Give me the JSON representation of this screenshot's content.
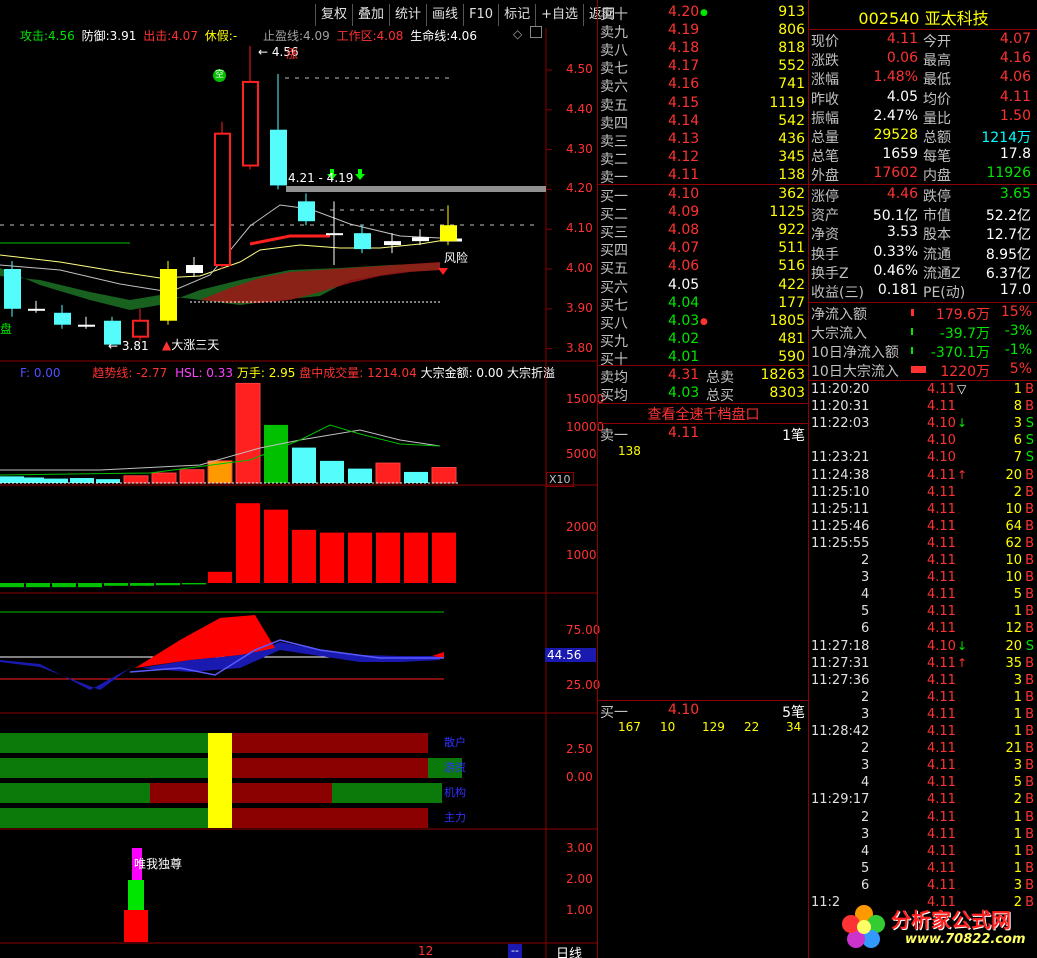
{
  "toolbar": [
    "复权",
    "叠加",
    "统计",
    "画线",
    "F10",
    "标记",
    "+自选",
    "返回"
  ],
  "main_indicator": {
    "attack_label": "攻击:",
    "attack_val": "4.56",
    "defense_label": "防御:",
    "defense_val": "3.91",
    "exit_label": "出击:",
    "exit_val": "4.07",
    "rest_label": "休假:",
    "rest_val": "-",
    "stop_label": "止盈线:",
    "stop_val": "4.09",
    "work_label": "工作区:",
    "work_val": "4.08",
    "life_label": "生命线:",
    "life_val": "4.06"
  },
  "price_axis": [
    "4.50",
    "4.40",
    "4.30",
    "4.20",
    "4.10",
    "4.00",
    "3.90",
    "3.80"
  ],
  "annotations": {
    "high": "4.56",
    "zhang": "涨",
    "range": "4.21 - 4.19",
    "low": "3.81",
    "dazhang": "大涨三天",
    "risk": "风险",
    "pan": "盘",
    "icon_text": "空"
  },
  "vol_indicator": {
    "f": "F: 0.00",
    "trend": "趋势线: -2.77",
    "hsl": "HSL: 0.33",
    "wanshou": "万手: 2.95",
    "pzcj": "盘中成交量: 1214.04",
    "dzje": "大宗金额: 0.00",
    "dzzy": "大宗折溢"
  },
  "vol_axis": [
    "15000",
    "10000",
    "5000"
  ],
  "vol_scale": "X10",
  "flow_axis": [
    "2000",
    "1000"
  ],
  "osc_axis": [
    "75.00",
    "25.00"
  ],
  "osc_value": "44.56",
  "band_axis": [
    "2.50",
    "0.00"
  ],
  "band_labels": [
    "散户",
    "游资",
    "机构",
    "主力"
  ],
  "sig_axis": [
    "3.00",
    "2.00",
    "1.00"
  ],
  "sig_label": "唯我独尊",
  "bottom_bar": {
    "day": "12",
    "dash": "--",
    "period": "日线"
  },
  "orderbook": {
    "sells": [
      {
        "label": "卖十",
        "price": "4.20",
        "vol": "913",
        "mark": "●"
      },
      {
        "label": "卖九",
        "price": "4.19",
        "vol": "806",
        "mark": ""
      },
      {
        "label": "卖八",
        "price": "4.18",
        "vol": "818",
        "mark": ""
      },
      {
        "label": "卖七",
        "price": "4.17",
        "vol": "552",
        "mark": ""
      },
      {
        "label": "卖六",
        "price": "4.16",
        "vol": "741",
        "mark": ""
      },
      {
        "label": "卖五",
        "price": "4.15",
        "vol": "1119",
        "mark": ""
      },
      {
        "label": "卖四",
        "price": "4.14",
        "vol": "542",
        "mark": ""
      },
      {
        "label": "卖三",
        "price": "4.13",
        "vol": "436",
        "mark": ""
      },
      {
        "label": "卖二",
        "price": "4.12",
        "vol": "345",
        "mark": ""
      },
      {
        "label": "卖一",
        "price": "4.11",
        "vol": "138",
        "mark": ""
      }
    ],
    "buys": [
      {
        "label": "买一",
        "price": "4.10",
        "vol": "362",
        "color": "red",
        "mark": ""
      },
      {
        "label": "买二",
        "price": "4.09",
        "vol": "1125",
        "color": "red",
        "mark": ""
      },
      {
        "label": "买三",
        "price": "4.08",
        "vol": "922",
        "color": "red",
        "mark": ""
      },
      {
        "label": "买四",
        "price": "4.07",
        "vol": "511",
        "color": "red",
        "mark": ""
      },
      {
        "label": "买五",
        "price": "4.06",
        "vol": "516",
        "color": "red",
        "mark": ""
      },
      {
        "label": "买六",
        "price": "4.05",
        "vol": "422",
        "color": "white",
        "mark": ""
      },
      {
        "label": "买七",
        "price": "4.04",
        "vol": "177",
        "color": "green",
        "mark": ""
      },
      {
        "label": "买八",
        "price": "4.03",
        "vol": "1805",
        "color": "green",
        "mark": "●"
      },
      {
        "label": "买九",
        "price": "4.02",
        "vol": "481",
        "color": "green",
        "mark": ""
      },
      {
        "label": "买十",
        "price": "4.01",
        "vol": "590",
        "color": "green",
        "mark": ""
      }
    ],
    "sell_avg_label": "卖均",
    "sell_avg": "4.31",
    "total_sell_label": "总卖",
    "total_sell": "18263",
    "buy_avg_label": "买均",
    "buy_avg": "4.03",
    "total_buy_label": "总买",
    "total_buy": "8303",
    "view_all": "查看全速千档盘口",
    "sell1_label": "卖一",
    "sell1_price": "4.11",
    "sell1_count": "1笔",
    "sell1_queue": [
      "138"
    ],
    "buy1_label": "买一",
    "buy1_price": "4.10",
    "buy1_count": "5笔",
    "buy1_queue": [
      "167",
      "10",
      "129",
      "22",
      "34"
    ]
  },
  "quote": {
    "code": "002540",
    "name": "亚太科技",
    "rows": [
      {
        "l1": "现价",
        "v1": "4.11",
        "c1": "red",
        "l2": "今开",
        "v2": "4.07",
        "c2": "red"
      },
      {
        "l1": "涨跌",
        "v1": "0.06",
        "c1": "red",
        "l2": "最高",
        "v2": "4.16",
        "c2": "red"
      },
      {
        "l1": "涨幅",
        "v1": "1.48%",
        "c1": "red",
        "l2": "最低",
        "v2": "4.06",
        "c2": "red"
      },
      {
        "l1": "昨收",
        "v1": "4.05",
        "c1": "white",
        "l2": "均价",
        "v2": "4.11",
        "c2": "red"
      },
      {
        "l1": "振幅",
        "v1": "2.47%",
        "c1": "white",
        "l2": "量比",
        "v2": "1.50",
        "c2": "red"
      },
      {
        "l1": "总量",
        "v1": "29528",
        "c1": "yellow",
        "l2": "总额",
        "v2": "1214万",
        "c2": "cyan"
      },
      {
        "l1": "总笔",
        "v1": "1659",
        "c1": "white",
        "l2": "每笔",
        "v2": "17.8",
        "c2": "white"
      },
      {
        "l1": "外盘",
        "v1": "17602",
        "c1": "red",
        "l2": "内盘",
        "v2": "11926",
        "c2": "green"
      }
    ],
    "rows2": [
      {
        "l1": "涨停",
        "v1": "4.46",
        "c1": "red",
        "l2": "跌停",
        "v2": "3.65",
        "c2": "green"
      },
      {
        "l1": "资产",
        "v1": "50.1亿",
        "c1": "white",
        "l2": "市值",
        "v2": "52.2亿",
        "c2": "white"
      },
      {
        "l1": "净资",
        "v1": "3.53",
        "c1": "white",
        "l2": "股本",
        "v2": "12.7亿",
        "c2": "white"
      },
      {
        "l1": "换手",
        "v1": "0.33%",
        "c1": "white",
        "l2": "流通",
        "v2": "8.95亿",
        "c2": "white"
      },
      {
        "l1": "换手Z",
        "v1": "0.46%",
        "c1": "white",
        "l2": "流通Z",
        "v2": "6.37亿",
        "c2": "white"
      },
      {
        "l1": "收益(三)",
        "v1": "0.181",
        "c1": "white",
        "l2": "PE(动)",
        "v2": "17.0",
        "c2": "white"
      }
    ],
    "flows": [
      {
        "label": "净流入额",
        "val": "179.6万",
        "vc": "red",
        "pct": "15%",
        "pc": "red",
        "bar": 0.03
      },
      {
        "label": "大宗流入",
        "val": "-39.7万",
        "vc": "green",
        "pct": "-3%",
        "pc": "green",
        "bar": 0.01
      },
      {
        "label": "10日净流入额",
        "val": "-370.1万",
        "vc": "green",
        "pct": "-1%",
        "pc": "green",
        "bar": 0.01
      },
      {
        "label": "10日大宗流入",
        "val": "1220万",
        "vc": "red",
        "pct": "5%",
        "pc": "red",
        "bar": 0.15
      }
    ]
  },
  "ticks": [
    {
      "time": "11:20:20",
      "price": "4.11",
      "arrow": "▽",
      "ac": "white",
      "vol": "1",
      "side": "B"
    },
    {
      "time": "11:20:31",
      "price": "4.11",
      "arrow": "",
      "ac": "red",
      "vol": "8",
      "side": "B"
    },
    {
      "time": "11:22:03",
      "price": "4.10",
      "arrow": "↓",
      "ac": "green",
      "vol": "3",
      "side": "S"
    },
    {
      "time": "",
      "price": "4.10",
      "arrow": "",
      "ac": "green",
      "vol": "6",
      "side": "S"
    },
    {
      "time": "11:23:21",
      "price": "4.10",
      "arrow": "",
      "ac": "green",
      "vol": "7",
      "side": "S"
    },
    {
      "time": "11:24:38",
      "price": "4.11",
      "arrow": "↑",
      "ac": "red",
      "vol": "20",
      "side": "B"
    },
    {
      "time": "11:25:10",
      "price": "4.11",
      "arrow": "",
      "ac": "red",
      "vol": "2",
      "side": "B"
    },
    {
      "time": "11:25:11",
      "price": "4.11",
      "arrow": "",
      "ac": "red",
      "vol": "10",
      "side": "B"
    },
    {
      "time": "11:25:46",
      "price": "4.11",
      "arrow": "",
      "ac": "red",
      "vol": "64",
      "side": "B"
    },
    {
      "time": "11:25:55",
      "price": "4.11",
      "arrow": "",
      "ac": "red",
      "vol": "62",
      "side": "B"
    },
    {
      "time": "",
      "num": "2",
      "price": "4.11",
      "arrow": "",
      "ac": "red",
      "vol": "10",
      "side": "B"
    },
    {
      "time": "",
      "num": "3",
      "price": "4.11",
      "arrow": "",
      "ac": "red",
      "vol": "10",
      "side": "B"
    },
    {
      "time": "",
      "num": "4",
      "price": "4.11",
      "arrow": "",
      "ac": "red",
      "vol": "5",
      "side": "B"
    },
    {
      "time": "",
      "num": "5",
      "price": "4.11",
      "arrow": "",
      "ac": "red",
      "vol": "1",
      "side": "B"
    },
    {
      "time": "",
      "num": "6",
      "price": "4.11",
      "arrow": "",
      "ac": "red",
      "vol": "12",
      "side": "B"
    },
    {
      "time": "11:27:18",
      "price": "4.10",
      "arrow": "↓",
      "ac": "green",
      "vol": "20",
      "side": "S"
    },
    {
      "time": "11:27:31",
      "price": "4.11",
      "arrow": "↑",
      "ac": "red",
      "vol": "35",
      "side": "B"
    },
    {
      "time": "11:27:36",
      "price": "4.11",
      "arrow": "",
      "ac": "red",
      "vol": "3",
      "side": "B"
    },
    {
      "time": "",
      "num": "2",
      "price": "4.11",
      "arrow": "",
      "ac": "red",
      "vol": "1",
      "side": "B"
    },
    {
      "time": "",
      "num": "3",
      "price": "4.11",
      "arrow": "",
      "ac": "red",
      "vol": "1",
      "side": "B"
    },
    {
      "time": "11:28:42",
      "price": "4.11",
      "arrow": "",
      "ac": "red",
      "vol": "1",
      "side": "B"
    },
    {
      "time": "",
      "num": "2",
      "price": "4.11",
      "arrow": "",
      "ac": "red",
      "vol": "21",
      "side": "B"
    },
    {
      "time": "",
      "num": "3",
      "price": "4.11",
      "arrow": "",
      "ac": "red",
      "vol": "3",
      "side": "B"
    },
    {
      "time": "",
      "num": "4",
      "price": "4.11",
      "arrow": "",
      "ac": "red",
      "vol": "5",
      "side": "B"
    },
    {
      "time": "11:29:17",
      "price": "4.11",
      "arrow": "",
      "ac": "red",
      "vol": "2",
      "side": "B"
    },
    {
      "time": "",
      "num": "2",
      "price": "4.11",
      "arrow": "",
      "ac": "red",
      "vol": "1",
      "side": "B"
    },
    {
      "time": "",
      "num": "3",
      "price": "4.11",
      "arrow": "",
      "ac": "red",
      "vol": "1",
      "side": "B"
    },
    {
      "time": "",
      "num": "4",
      "price": "4.11",
      "arrow": "",
      "ac": "red",
      "vol": "1",
      "side": "B"
    },
    {
      "time": "",
      "num": "5",
      "price": "4.11",
      "arrow": "",
      "ac": "red",
      "vol": "1",
      "side": "B"
    },
    {
      "time": "",
      "num": "6",
      "price": "4.11",
      "arrow": "",
      "ac": "red",
      "vol": "3",
      "side": "B"
    },
    {
      "time": "11:2",
      "price": "4.11",
      "arrow": "",
      "ac": "red",
      "vol": "2",
      "side": "B"
    }
  ],
  "watermark": {
    "text": "分析家公式网",
    "url": "www.70822.com"
  },
  "colors": {
    "up": "#ff3232",
    "down": "#00e600",
    "grid": "#8b0000",
    "cyan_candle": "#54fcfc"
  }
}
